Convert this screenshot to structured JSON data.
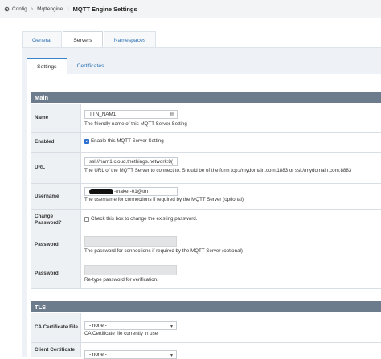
{
  "breadcrumb": {
    "config": "Config",
    "module": "Mqttengine",
    "title": "MQTT Engine Settings"
  },
  "tabs_top": [
    "General",
    "Servers",
    "Namespaces"
  ],
  "tabs_sub": [
    "Settings",
    "Certificates"
  ],
  "sections": {
    "main": "Main",
    "tls": "TLS"
  },
  "fields": {
    "name": {
      "label": "Name",
      "value": "TTN_NAM1",
      "help": "The friendly name of this MQTT Server Setting"
    },
    "enabled": {
      "label": "Enabled",
      "text": "Enable this MQTT Server Setting",
      "checked": true
    },
    "url": {
      "label": "URL",
      "value": "ssl://nam1.cloud.thethings.network:8(",
      "help": "The URL of the MQTT Server to connect to. Should be of the form tcp://mydomain.com:1883 or ssl://mydomain.com:8883"
    },
    "username": {
      "label": "Username",
      "value": "-maker-01@ttn",
      "help": "The username for connections if required by the MQTT Server (optional)"
    },
    "change_password": {
      "label1": "Change",
      "label2": "Password?",
      "text": "Check this box to change the existing password."
    },
    "password": {
      "label": "Password",
      "help": "The password for connections if required by the MQTT Server (optional)"
    },
    "password2": {
      "label": "Password",
      "help": "Re-type password for verification."
    },
    "ca_cert": {
      "label": "CA Certificate File",
      "value": "- none -",
      "help": "CA Certificate file currently in use"
    },
    "client_cert": {
      "label": "Client Certificate",
      "value": "- none -"
    }
  }
}
